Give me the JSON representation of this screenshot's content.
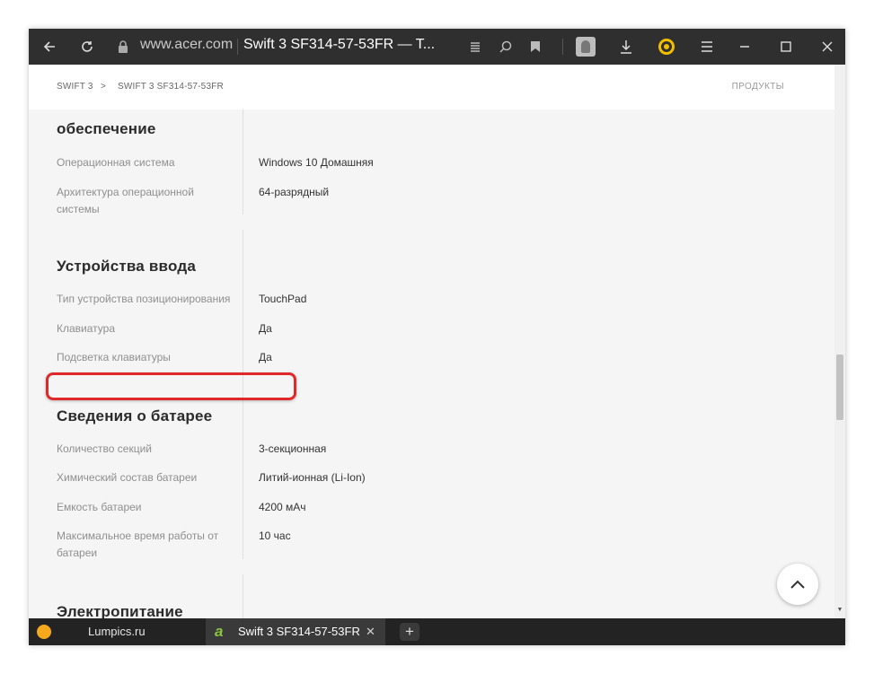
{
  "browser": {
    "url_domain": "www.acer.com",
    "tab_title": "Swift 3 SF314-57-53FR — T...",
    "icons": [
      "back-icon",
      "reload-icon",
      "lock-icon",
      "reader-icon",
      "search-icon",
      "bookmark-icon",
      "profile-icon",
      "download-icon",
      "alice-icon",
      "menu-icon",
      "minimize-icon",
      "maximize-icon",
      "close-icon"
    ]
  },
  "header": {
    "breadcrumb_1": "SWIFT 3",
    "breadcrumb_sep": ">",
    "breadcrumb_2": "SWIFT 3 SF314-57-53FR",
    "products": "ПРОДУКТЫ"
  },
  "sections": {
    "software": {
      "heading": "обеспечение",
      "rows": [
        {
          "label": "Операционная система",
          "value": "Windows 10 Домашняя"
        },
        {
          "label": "Архитектура операционной системы",
          "value": "64-разрядный"
        }
      ]
    },
    "input": {
      "heading": "Устройства ввода",
      "rows": [
        {
          "label": "Тип устройства позиционирования",
          "value": "TouchPad"
        },
        {
          "label": "Клавиатура",
          "value": "Да"
        },
        {
          "label": "Подсветка клавиатуры",
          "value": "Да"
        }
      ]
    },
    "battery": {
      "heading": "Сведения о батарее",
      "rows": [
        {
          "label": "Количество секций",
          "value": "3-секционная"
        },
        {
          "label": "Химический состав батареи",
          "value": "Литий-ионная (Li-Ion)"
        },
        {
          "label": "Емкость батареи",
          "value": "4200 мАч"
        },
        {
          "label": "Максимальное время работы от батареи",
          "value": "10 час"
        }
      ]
    },
    "power": {
      "heading": "Электропитание"
    }
  },
  "tabs": [
    {
      "label": "Lumpics.ru"
    },
    {
      "label": "Swift 3 SF314-57-53FR"
    }
  ],
  "tab_close": "✕",
  "tab_new": "+",
  "colors": {
    "highlight": "#e0282a",
    "titlebar": "#2f2f2f",
    "tabbar": "#232323",
    "accent_logo": "#8bc53f"
  }
}
